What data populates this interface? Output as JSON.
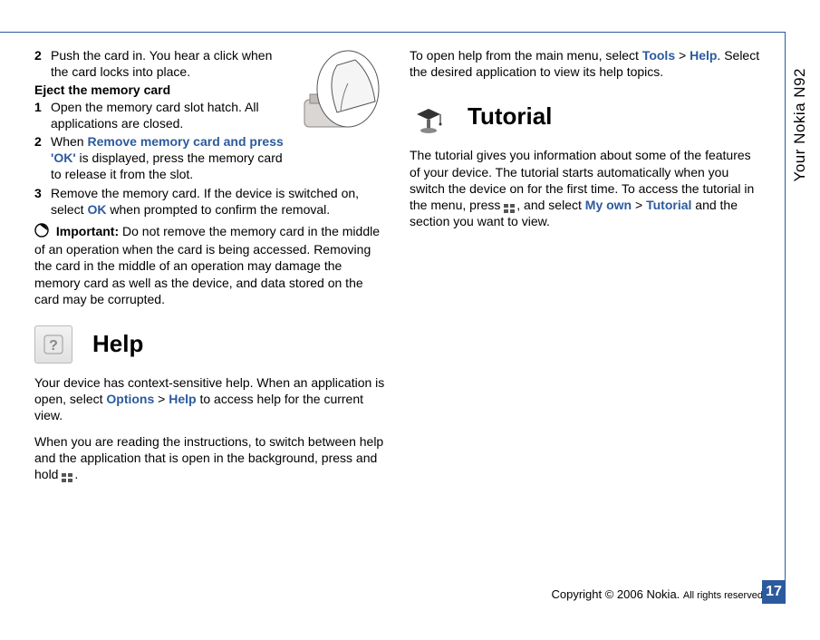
{
  "vertical_title": "Your Nokia N92",
  "left": {
    "step2": {
      "num": "2",
      "text": "Push the card in. You hear a click when the card locks into place."
    },
    "eject_heading": "Eject the memory card",
    "eject1": {
      "num": "1",
      "text": "Open the memory card slot hatch. All applications are closed."
    },
    "eject2": {
      "num": "2",
      "pre": "When ",
      "link": "Remove memory card and press 'OK'",
      "post": " is displayed, press the memory card to release it from the slot."
    },
    "eject3": {
      "num": "3",
      "pre": "Remove the memory card. If the device is switched on, select ",
      "link": "OK",
      "post": " when prompted to confirm the removal."
    },
    "important_label": "Important:",
    "important_text": " Do not remove the memory card in the middle of an operation when the card is being accessed. Removing the card in the middle of an operation may damage the memory card as well as the device, and data stored on the card may be corrupted.",
    "help_heading": "Help",
    "help_p1": {
      "pre": "Your device has context-sensitive help. When an application is open, select ",
      "link1": "Options",
      "sep": " > ",
      "link2": "Help",
      "post": " to access help for the current view."
    },
    "help_p2": "When you are reading the instructions, to switch between help and the application that is open in the background, press and hold ",
    "help_p2_post": "."
  },
  "right": {
    "open_help": {
      "pre": "To open help from the main menu, select ",
      "link1": "Tools",
      "sep": " > ",
      "link2": "Help",
      "post": ". Select the desired application to view its help topics."
    },
    "tutorial_heading": "Tutorial",
    "tutorial_p": {
      "pre": "The tutorial gives you information about some of the features of your device. The tutorial starts automatically when you switch the device on for the first time. To access the tutorial in the menu, press ",
      "mid": ", and select ",
      "link1": "My own",
      "sep": " > ",
      "link2": "Tutorial",
      "post": " and the section you want to view."
    }
  },
  "footer": {
    "copyright1": "Copyright © 2006 Nokia. ",
    "copyright2": "All rights reserved.",
    "page": "17"
  }
}
